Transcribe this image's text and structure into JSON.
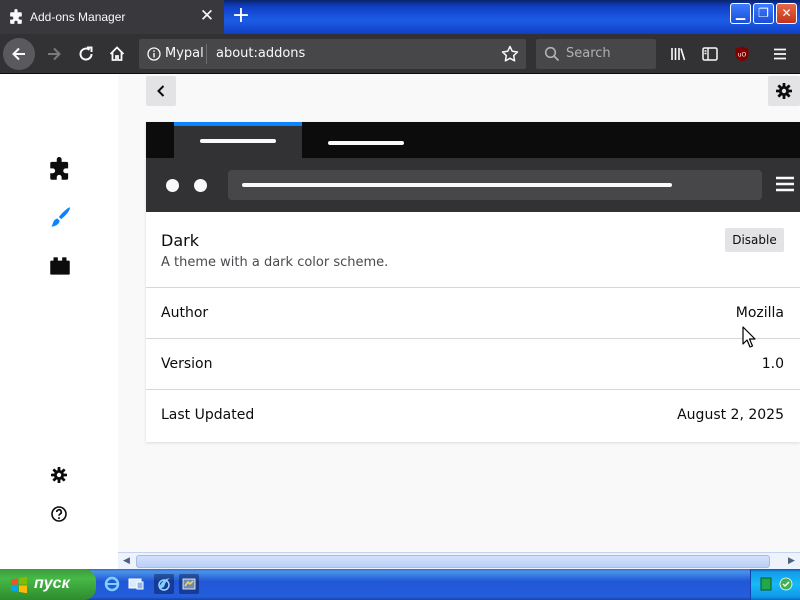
{
  "window": {
    "tab_title": "Add-ons Manager",
    "tab_icon": "puzzle-icon",
    "controls": {
      "minimize": "minimize-icon",
      "maximize": "restore-icon",
      "close": "close-icon"
    }
  },
  "navbar": {
    "identity_label": "Mypal",
    "url": "about:addons",
    "search_placeholder": "Search"
  },
  "sidebar": {
    "categories": [
      {
        "name": "extensions",
        "icon": "puzzle-icon"
      },
      {
        "name": "themes",
        "icon": "brush-icon",
        "selected": true
      },
      {
        "name": "plugins",
        "icon": "plugin-icon"
      }
    ]
  },
  "theme_preview": {
    "accent_color": "#0a84ff",
    "frame_color": "#0c0c0d",
    "toolbar_color": "#323234",
    "field_color": "#474749"
  },
  "addon": {
    "name": "Dark",
    "description": "A theme with a dark color scheme.",
    "disable_label": "Disable",
    "details": [
      {
        "label": "Author",
        "value": "Mozilla"
      },
      {
        "label": "Version",
        "value": "1.0"
      },
      {
        "label": "Last Updated",
        "value": "August 2, 2025"
      }
    ]
  },
  "taskbar": {
    "start_label": "пуск"
  },
  "colors": {
    "accent": "#0a84ff",
    "toolbar": "#323234",
    "tab": "#38383d"
  }
}
